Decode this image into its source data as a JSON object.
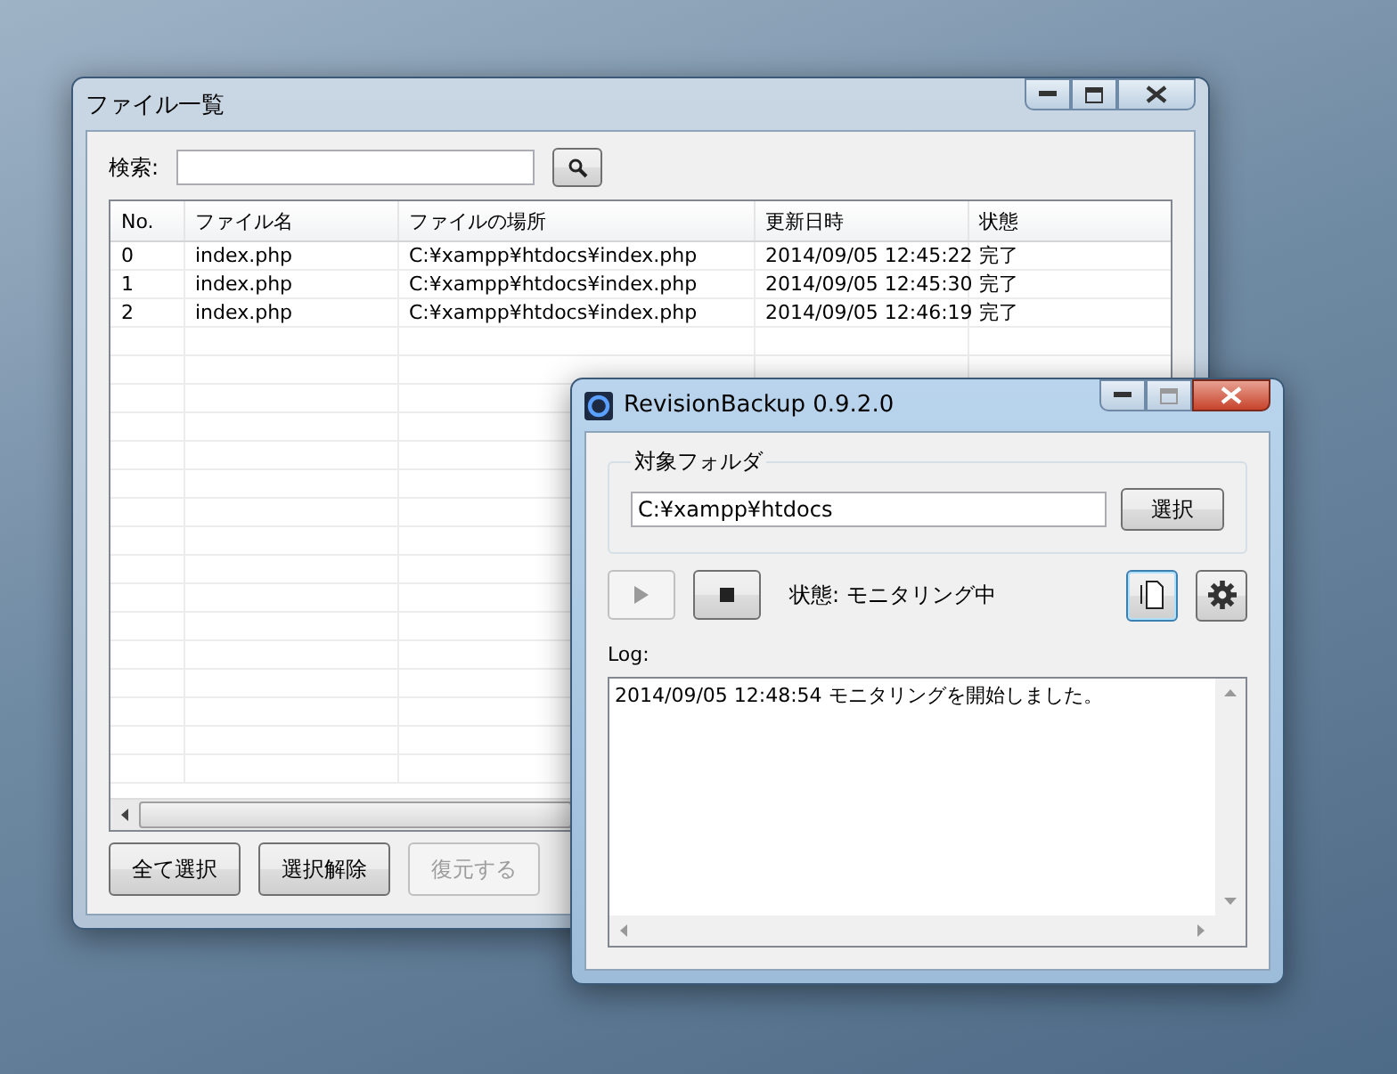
{
  "file_list_window": {
    "title": "ファイル一覧",
    "active": false,
    "search": {
      "label": "検索:"
    },
    "table": {
      "columns": [
        "No.",
        "ファイル名",
        "ファイルの場所",
        "更新日時",
        "状態"
      ],
      "rows": [
        [
          "0",
          "index.php",
          "C:¥xampp¥htdocs¥index.php",
          "2014/09/05 12:45:22",
          "完了"
        ],
        [
          "1",
          "index.php",
          "C:¥xampp¥htdocs¥index.php",
          "2014/09/05 12:45:30",
          "完了"
        ],
        [
          "2",
          "index.php",
          "C:¥xampp¥htdocs¥index.php",
          "2014/09/05 12:46:19",
          "完了"
        ]
      ]
    },
    "buttons": [
      {
        "label": "全て選択",
        "disabled": false
      },
      {
        "label": "選択解除",
        "disabled": false
      },
      {
        "label": "復元する",
        "disabled": true
      }
    ]
  },
  "backup_window": {
    "title": "RevisionBackup 0.9.2.0",
    "active": true,
    "folder_group": {
      "label": "対象フォルダ",
      "value": "C:¥xampp¥htdocs",
      "button": "選択"
    },
    "controls": [
      {
        "kind": "play",
        "disabled": true
      },
      {
        "kind": "stop",
        "disabled": false
      }
    ],
    "status": "状態: モニタリング中",
    "tools": [
      {
        "kind": "document",
        "focused": true
      },
      {
        "kind": "settings",
        "focused": false
      }
    ],
    "log": {
      "label": "Log:",
      "lines": [
        "2014/09/05 12:48:54 モニタリングを開始しました。"
      ]
    }
  }
}
